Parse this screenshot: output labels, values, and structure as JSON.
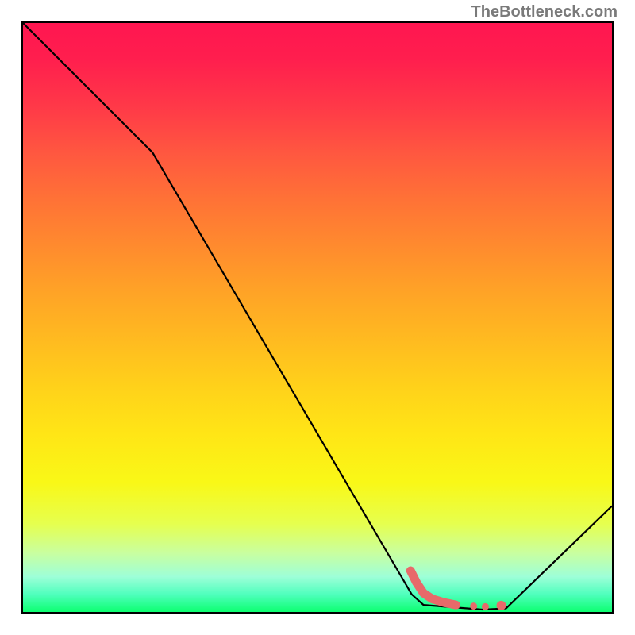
{
  "watermark": "TheBottleneck.com",
  "chart_data": {
    "type": "line",
    "title": "",
    "xlabel": "",
    "ylabel": "",
    "xlim": [
      0,
      100
    ],
    "ylim": [
      0,
      100
    ],
    "curve": [
      {
        "x": 0,
        "y": 100
      },
      {
        "x": 22,
        "y": 78
      },
      {
        "x": 66,
        "y": 3
      },
      {
        "x": 68,
        "y": 1.2
      },
      {
        "x": 78,
        "y": 0.4
      },
      {
        "x": 82,
        "y": 0.6
      },
      {
        "x": 100,
        "y": 18
      }
    ],
    "elbow_marker": {
      "points": [
        {
          "x": 65.8,
          "y": 7.0
        },
        {
          "x": 66.8,
          "y": 5.0
        },
        {
          "x": 68.0,
          "y": 3.2
        },
        {
          "x": 69.5,
          "y": 2.2
        },
        {
          "x": 71.5,
          "y": 1.6
        },
        {
          "x": 73.5,
          "y": 1.2
        }
      ],
      "dots": [
        {
          "x": 76.5,
          "y": 1.0
        },
        {
          "x": 78.5,
          "y": 0.9
        },
        {
          "x": 81.2,
          "y": 1.1
        }
      ],
      "color": "#e86a6a"
    }
  }
}
